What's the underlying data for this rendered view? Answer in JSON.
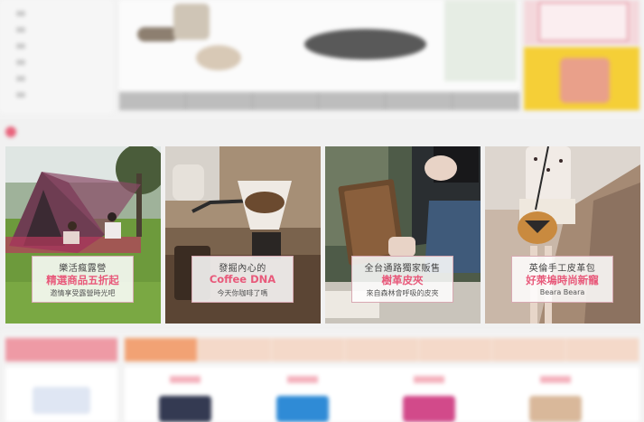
{
  "sidebar": {
    "items": [
      {
        "label": ""
      },
      {
        "label": ""
      },
      {
        "label": ""
      },
      {
        "label": ""
      },
      {
        "label": ""
      },
      {
        "label": ""
      }
    ]
  },
  "hero": {
    "thumbs": [
      "",
      "",
      "",
      "",
      "",
      ""
    ]
  },
  "section": {
    "title": ""
  },
  "cards": [
    {
      "line1": "樂活瘋露營",
      "line2": "精選商品五折起",
      "line3": "邀情享受露營時光吧",
      "scene": "camping-tent"
    },
    {
      "line1": "發掘內心的",
      "line2": "Coffee DNA",
      "line3": "今天你咖啡了嗎",
      "scene": "coffee-pour-over"
    },
    {
      "line1": "全台通路獨家販售",
      "line2": "樹革皮夾",
      "line3": "來自森林會呼吸的皮夾",
      "scene": "wood-wallet"
    },
    {
      "line1": "英倫手工皮革包",
      "line2": "好萊塢時尚新寵",
      "line3": "Beara Beara",
      "scene": "leather-bag"
    }
  ],
  "bottom": {
    "left_tab": "",
    "tabs": [
      "",
      "",
      "",
      "",
      "",
      "",
      ""
    ]
  },
  "colors": {
    "accent_pink": "#e8597a",
    "tab_orange": "#f2a274"
  }
}
